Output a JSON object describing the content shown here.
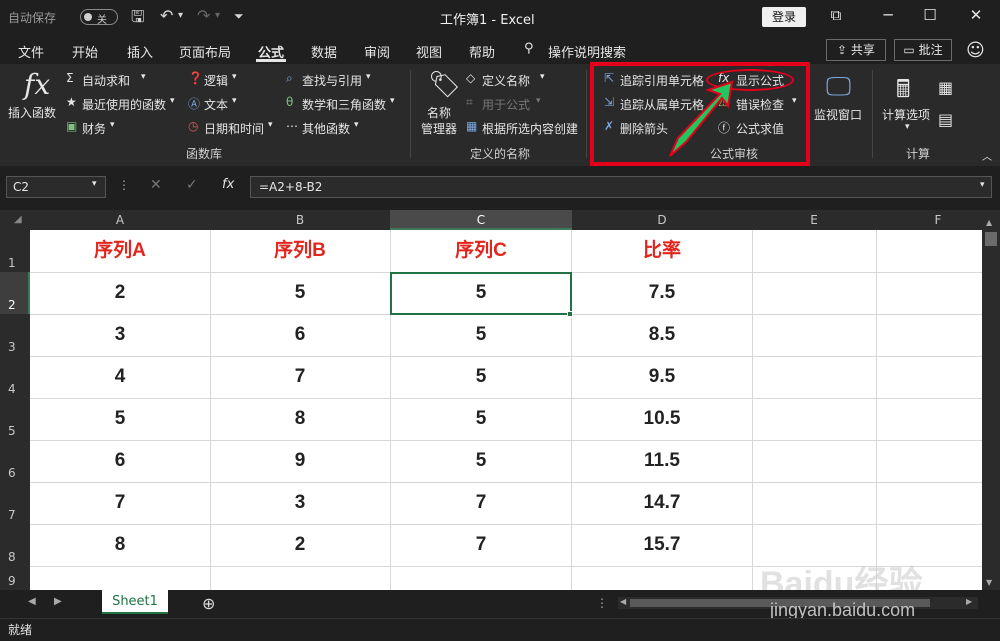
{
  "titlebar": {
    "autosave_label": "自动保存",
    "autosave_state": "关",
    "doc_title": "工作簿1  -  Excel",
    "login": "登录"
  },
  "menu": {
    "tabs": [
      "文件",
      "开始",
      "插入",
      "页面布局",
      "公式",
      "数据",
      "审阅",
      "视图",
      "帮助",
      "操作说明搜索"
    ],
    "active_tab": "公式",
    "share": "共享",
    "comment": "批注"
  },
  "ribbon": {
    "function_library": {
      "insert_function": "插入函数",
      "autosum": "自动求和",
      "recent": "最近使用的函数",
      "financial": "财务",
      "logical": "逻辑",
      "text": "文本",
      "datetime": "日期和时间",
      "lookup": "查找与引用",
      "math": "数学和三角函数",
      "more": "其他函数",
      "label": "函数库"
    },
    "defined_names": {
      "name_manager_1": "名称",
      "name_manager_2": "管理器",
      "define_name": "定义名称",
      "use_in_formula": "用于公式",
      "create_from_selection": "根据所选内容创建",
      "label": "定义的名称"
    },
    "formula_auditing": {
      "trace_precedents": "追踪引用单元格",
      "trace_dependents": "追踪从属单元格",
      "remove_arrows": "删除箭头",
      "show_formulas": "显示公式",
      "error_checking": "错误检查",
      "evaluate_formula": "公式求值",
      "label": "公式审核"
    },
    "watch_window": "监视窗口",
    "calculation": {
      "options": "计算选项",
      "label": "计算"
    }
  },
  "formula_bar": {
    "name_box": "C2",
    "formula": "=A2+8-B2",
    "fx": "fx"
  },
  "sheet": {
    "columns": [
      "A",
      "B",
      "C",
      "D",
      "E",
      "F"
    ],
    "rows": [
      "1",
      "2",
      "3",
      "4",
      "5",
      "6",
      "7",
      "8",
      "9"
    ],
    "headers": [
      "序列A",
      "序列B",
      "序列C",
      "比率"
    ],
    "data": [
      [
        "2",
        "5",
        "5",
        "7.5"
      ],
      [
        "3",
        "6",
        "5",
        "8.5"
      ],
      [
        "4",
        "7",
        "5",
        "9.5"
      ],
      [
        "5",
        "8",
        "5",
        "10.5"
      ],
      [
        "6",
        "9",
        "5",
        "11.5"
      ],
      [
        "7",
        "3",
        "7",
        "14.7"
      ],
      [
        "8",
        "2",
        "7",
        "15.7"
      ]
    ],
    "selected_cell": "C2",
    "sheet_tab": "Sheet1"
  },
  "status": {
    "ready": "就绪"
  },
  "watermark": {
    "logo": "Baidu经验",
    "url": "jingyan.baidu.com"
  },
  "colors": {
    "header_red": "#e2261e",
    "highlight_red": "#e4001a",
    "arrow_green": "#22c55e",
    "excel_green": "#217346"
  }
}
